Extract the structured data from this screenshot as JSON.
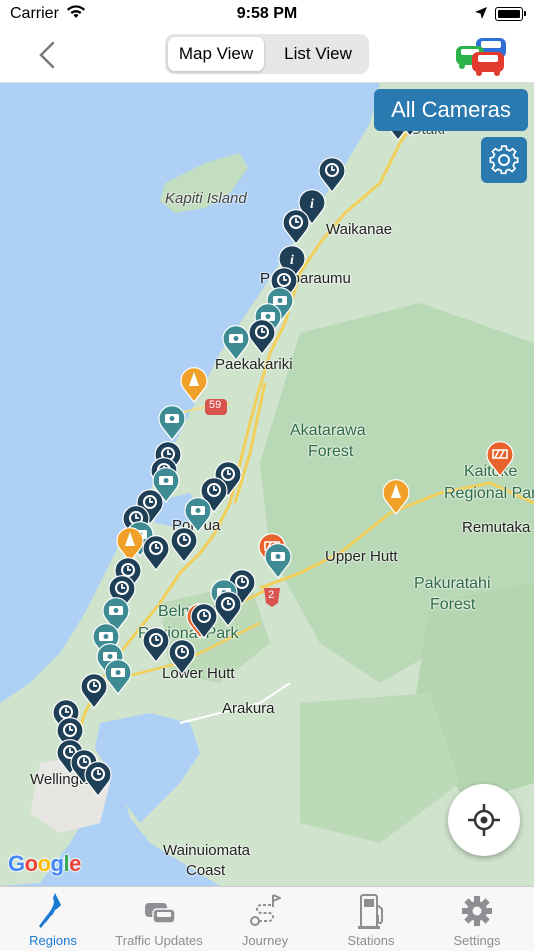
{
  "status_bar": {
    "carrier": "Carrier",
    "time": "9:58 PM"
  },
  "nav": {
    "segments": [
      {
        "label": "Map View",
        "selected": true
      },
      {
        "label": "List View",
        "selected": false
      }
    ]
  },
  "map": {
    "all_cameras_label": "All Cameras",
    "attribution": "Google",
    "labels": {
      "kapiti_island": "Kapiti Island",
      "waikanae": "Waikanae",
      "paraparaumu": "Paraparaumu",
      "paekakariki": "Paekakariki",
      "akatarawa_1": "Akatarawa",
      "akatarawa_2": "Forest",
      "kaitoke_1": "Kaitoke",
      "kaitoke_2": "Regional Park",
      "remutaka": "Remutaka Range",
      "porirua": "Porirua",
      "upper_hutt": "Upper Hutt",
      "pakuratahi_1": "Pakuratahi",
      "pakuratahi_2": "Forest",
      "belmont_1": "Belmont",
      "belmont_2": "Regional Park",
      "lower_hutt": "Lower Hutt",
      "arakura": "Arakura",
      "wellington": "Wellington",
      "wainuiomata_1": "Wainuiomata",
      "wainuiomata_2": "Coast",
      "otaki": "Otaki",
      "highway_59": "59",
      "highway_2": "2"
    },
    "colors": {
      "pin_clock": "#1f3f56",
      "pin_camera": "#3e8b93",
      "pin_cone": "#f0a12a",
      "pin_roadworks": "#e8622c",
      "accent": "#2a79b0"
    }
  },
  "tabs": [
    {
      "label": "Regions",
      "icon": "nz-map-icon",
      "active": true
    },
    {
      "label": "Traffic Updates",
      "icon": "traffic-cars-icon",
      "active": false
    },
    {
      "label": "Journey",
      "icon": "journey-route-icon",
      "active": false
    },
    {
      "label": "Stations",
      "icon": "fuel-pump-icon",
      "active": false
    },
    {
      "label": "Settings",
      "icon": "gear-icon",
      "active": false
    }
  ]
}
